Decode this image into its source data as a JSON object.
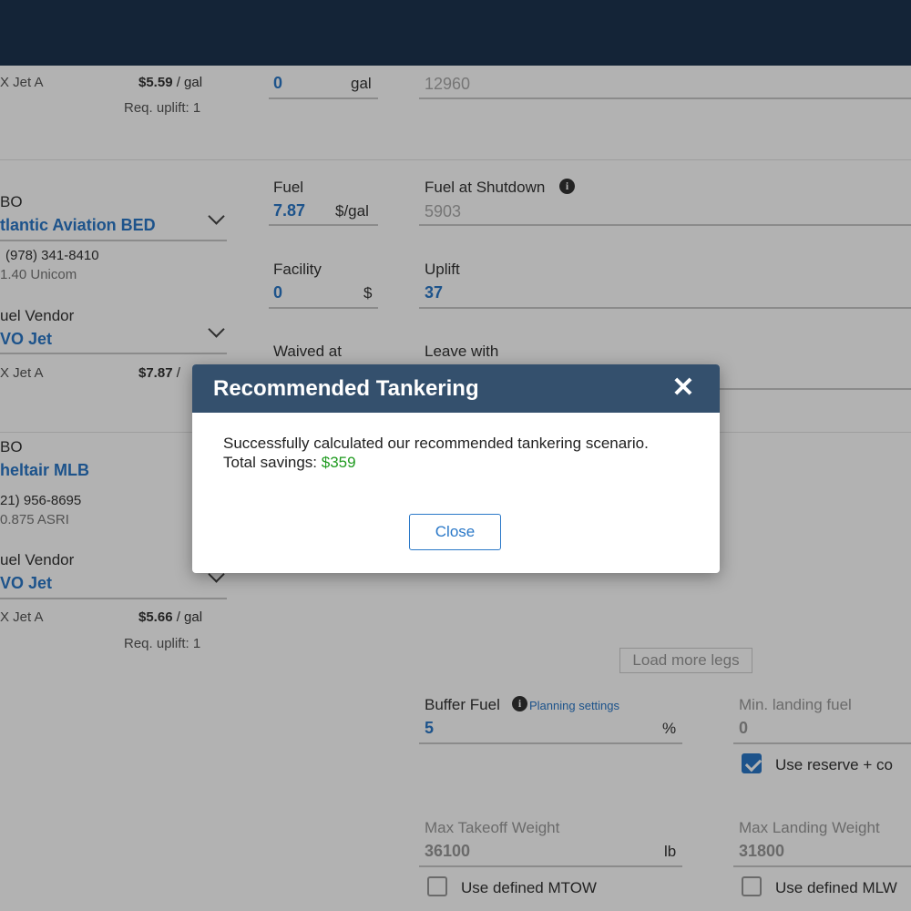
{
  "left": {
    "row1": {
      "fuel_type": "X Jet A",
      "price": "$5.59",
      "price_unit": " / gal",
      "req_uplift": "Req. uplift: 1"
    },
    "fbo1": {
      "label": "BO",
      "name": "tlantic Aviation BED",
      "phone": "(978) 341-8410",
      "freq": "1.40 Unicom"
    },
    "vendor1": {
      "label": "uel Vendor",
      "name": "VO Jet",
      "fuel_type": "X Jet A",
      "price": "$7.87",
      "price_unit": " /"
    },
    "fbo2": {
      "label": "BO",
      "name": "heltair MLB",
      "phone": "21) 956-8695",
      "freq": "0.875 ASRI"
    },
    "vendor2": {
      "label": "uel Vendor",
      "name": "VO Jet",
      "fuel_type": "X Jet A",
      "price": "$5.66",
      "price_unit": " / gal",
      "req_uplift": "Req. uplift: 1"
    }
  },
  "mid": {
    "gal_value": "0",
    "gal_unit": "gal",
    "fuel_label": "Fuel",
    "fuel_value": "7.87",
    "fuel_unit": "$/gal",
    "facility_label": "Facility",
    "facility_value": "0",
    "facility_unit": "$",
    "waived_label": "Waived at"
  },
  "right": {
    "top_value": "12960",
    "shutdown_label": "Fuel at Shutdown",
    "shutdown_value": "5903",
    "uplift_label": "Uplift",
    "uplift_value": "37",
    "leave_label": "Leave with"
  },
  "bottom": {
    "load_more": "Load more legs",
    "buffer_label": "Buffer Fuel",
    "planning_link": "Planning settings",
    "buffer_value": "5",
    "buffer_unit": "%",
    "min_landing_label": "Min. landing fuel",
    "min_landing_value": "0",
    "use_reserve_label": "Use reserve + co",
    "mtow_label": "Max Takeoff Weight",
    "mtow_value": "36100",
    "mtow_unit": "lb",
    "mlw_label": "Max Landing Weight",
    "mlw_value": "31800",
    "use_mtow_label": "Use defined MTOW",
    "use_mlw_label": "Use defined MLW"
  },
  "modal": {
    "title": "Recommended Tankering",
    "message": "Successfully calculated our recommended tankering scenario.",
    "savings_label": "Total savings: ",
    "savings_value": "$359",
    "close_label": "Close"
  },
  "colors": {
    "topbar": "#1e344f",
    "modal_header": "#34506d",
    "accent": "#2a78c8",
    "savings": "#1f9a1f"
  },
  "icons": {
    "close": "close-icon",
    "info": "info-icon",
    "chevron": "chevron-down-icon",
    "check": "check-icon"
  }
}
